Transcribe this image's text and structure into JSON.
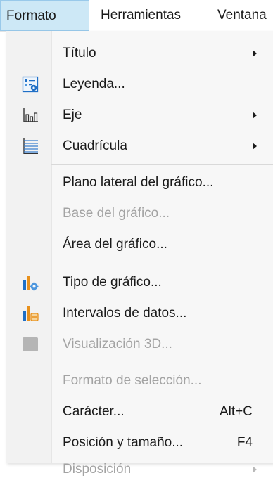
{
  "menubar": {
    "items": [
      {
        "label": "Formato"
      },
      {
        "label": "Herramientas"
      },
      {
        "label": "Ventana"
      }
    ]
  },
  "menu": {
    "items": [
      {
        "label": "Título",
        "submenu": true,
        "enabled": true,
        "icon": ""
      },
      {
        "label": "Leyenda...",
        "enabled": true,
        "icon": "legend-icon"
      },
      {
        "label": "Eje",
        "submenu": true,
        "enabled": true,
        "icon": "axis-icon"
      },
      {
        "label": "Cuadrícula",
        "submenu": true,
        "enabled": true,
        "icon": "grid-icon"
      },
      {
        "label": "Plano lateral del gráfico...",
        "enabled": true,
        "icon": ""
      },
      {
        "label": "Base del gráfico...",
        "enabled": false,
        "icon": ""
      },
      {
        "label": "Área del gráfico...",
        "enabled": true,
        "icon": ""
      },
      {
        "label": "Tipo de gráfico...",
        "enabled": true,
        "icon": "chart-type-icon"
      },
      {
        "label": "Intervalos de datos...",
        "enabled": true,
        "icon": "data-ranges-icon"
      },
      {
        "label": "Visualización 3D...",
        "enabled": false,
        "icon": "3d-view-icon"
      },
      {
        "label": "Formato de selección...",
        "enabled": false,
        "icon": ""
      },
      {
        "label": "Carácter...",
        "shortcut": "Alt+C",
        "enabled": true,
        "icon": ""
      },
      {
        "label": "Posición y tamaño...",
        "shortcut": "F4",
        "enabled": true,
        "icon": ""
      },
      {
        "label": "Disposición",
        "submenu": true,
        "enabled": false,
        "icon": ""
      }
    ]
  },
  "colors": {
    "active_menu_bg": "#cde8f6",
    "active_menu_border": "#99c9ea",
    "disabled_text": "#a3a3a3",
    "icon_blue": "#1f6fc6",
    "icon_orange": "#e8901c"
  }
}
